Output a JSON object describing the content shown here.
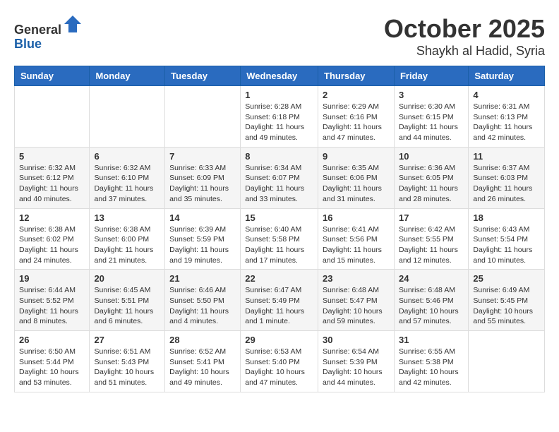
{
  "header": {
    "logo_general": "General",
    "logo_blue": "Blue",
    "month": "October 2025",
    "location": "Shaykh al Hadid, Syria"
  },
  "weekdays": [
    "Sunday",
    "Monday",
    "Tuesday",
    "Wednesday",
    "Thursday",
    "Friday",
    "Saturday"
  ],
  "weeks": [
    [
      {
        "day": "",
        "info": ""
      },
      {
        "day": "",
        "info": ""
      },
      {
        "day": "",
        "info": ""
      },
      {
        "day": "1",
        "info": "Sunrise: 6:28 AM\nSunset: 6:18 PM\nDaylight: 11 hours\nand 49 minutes."
      },
      {
        "day": "2",
        "info": "Sunrise: 6:29 AM\nSunset: 6:16 PM\nDaylight: 11 hours\nand 47 minutes."
      },
      {
        "day": "3",
        "info": "Sunrise: 6:30 AM\nSunset: 6:15 PM\nDaylight: 11 hours\nand 44 minutes."
      },
      {
        "day": "4",
        "info": "Sunrise: 6:31 AM\nSunset: 6:13 PM\nDaylight: 11 hours\nand 42 minutes."
      }
    ],
    [
      {
        "day": "5",
        "info": "Sunrise: 6:32 AM\nSunset: 6:12 PM\nDaylight: 11 hours\nand 40 minutes."
      },
      {
        "day": "6",
        "info": "Sunrise: 6:32 AM\nSunset: 6:10 PM\nDaylight: 11 hours\nand 37 minutes."
      },
      {
        "day": "7",
        "info": "Sunrise: 6:33 AM\nSunset: 6:09 PM\nDaylight: 11 hours\nand 35 minutes."
      },
      {
        "day": "8",
        "info": "Sunrise: 6:34 AM\nSunset: 6:07 PM\nDaylight: 11 hours\nand 33 minutes."
      },
      {
        "day": "9",
        "info": "Sunrise: 6:35 AM\nSunset: 6:06 PM\nDaylight: 11 hours\nand 31 minutes."
      },
      {
        "day": "10",
        "info": "Sunrise: 6:36 AM\nSunset: 6:05 PM\nDaylight: 11 hours\nand 28 minutes."
      },
      {
        "day": "11",
        "info": "Sunrise: 6:37 AM\nSunset: 6:03 PM\nDaylight: 11 hours\nand 26 minutes."
      }
    ],
    [
      {
        "day": "12",
        "info": "Sunrise: 6:38 AM\nSunset: 6:02 PM\nDaylight: 11 hours\nand 24 minutes."
      },
      {
        "day": "13",
        "info": "Sunrise: 6:38 AM\nSunset: 6:00 PM\nDaylight: 11 hours\nand 21 minutes."
      },
      {
        "day": "14",
        "info": "Sunrise: 6:39 AM\nSunset: 5:59 PM\nDaylight: 11 hours\nand 19 minutes."
      },
      {
        "day": "15",
        "info": "Sunrise: 6:40 AM\nSunset: 5:58 PM\nDaylight: 11 hours\nand 17 minutes."
      },
      {
        "day": "16",
        "info": "Sunrise: 6:41 AM\nSunset: 5:56 PM\nDaylight: 11 hours\nand 15 minutes."
      },
      {
        "day": "17",
        "info": "Sunrise: 6:42 AM\nSunset: 5:55 PM\nDaylight: 11 hours\nand 12 minutes."
      },
      {
        "day": "18",
        "info": "Sunrise: 6:43 AM\nSunset: 5:54 PM\nDaylight: 11 hours\nand 10 minutes."
      }
    ],
    [
      {
        "day": "19",
        "info": "Sunrise: 6:44 AM\nSunset: 5:52 PM\nDaylight: 11 hours\nand 8 minutes."
      },
      {
        "day": "20",
        "info": "Sunrise: 6:45 AM\nSunset: 5:51 PM\nDaylight: 11 hours\nand 6 minutes."
      },
      {
        "day": "21",
        "info": "Sunrise: 6:46 AM\nSunset: 5:50 PM\nDaylight: 11 hours\nand 4 minutes."
      },
      {
        "day": "22",
        "info": "Sunrise: 6:47 AM\nSunset: 5:49 PM\nDaylight: 11 hours\nand 1 minute."
      },
      {
        "day": "23",
        "info": "Sunrise: 6:48 AM\nSunset: 5:47 PM\nDaylight: 10 hours\nand 59 minutes."
      },
      {
        "day": "24",
        "info": "Sunrise: 6:48 AM\nSunset: 5:46 PM\nDaylight: 10 hours\nand 57 minutes."
      },
      {
        "day": "25",
        "info": "Sunrise: 6:49 AM\nSunset: 5:45 PM\nDaylight: 10 hours\nand 55 minutes."
      }
    ],
    [
      {
        "day": "26",
        "info": "Sunrise: 6:50 AM\nSunset: 5:44 PM\nDaylight: 10 hours\nand 53 minutes."
      },
      {
        "day": "27",
        "info": "Sunrise: 6:51 AM\nSunset: 5:43 PM\nDaylight: 10 hours\nand 51 minutes."
      },
      {
        "day": "28",
        "info": "Sunrise: 6:52 AM\nSunset: 5:41 PM\nDaylight: 10 hours\nand 49 minutes."
      },
      {
        "day": "29",
        "info": "Sunrise: 6:53 AM\nSunset: 5:40 PM\nDaylight: 10 hours\nand 47 minutes."
      },
      {
        "day": "30",
        "info": "Sunrise: 6:54 AM\nSunset: 5:39 PM\nDaylight: 10 hours\nand 44 minutes."
      },
      {
        "day": "31",
        "info": "Sunrise: 6:55 AM\nSunset: 5:38 PM\nDaylight: 10 hours\nand 42 minutes."
      },
      {
        "day": "",
        "info": ""
      }
    ]
  ]
}
